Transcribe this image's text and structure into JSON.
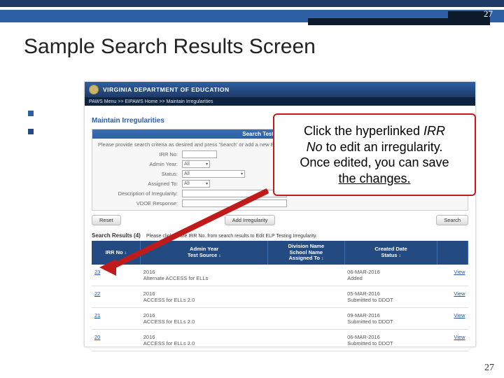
{
  "page_top": "27",
  "page_bottom": "27",
  "slide_title": "Sample Search Results Screen",
  "vdoe": {
    "title": "VIRGINIA DEPARTMENT OF EDUCATION",
    "crumb": "PAWS Menu >> EIPAWS Home >> Maintain Irregularities",
    "maintain": "Maintain Irregularities",
    "panel_hd": "Search Testing Irregularities",
    "intro": "Please provide search criteria as desired and press 'Search' or add a new ELP Testing Irregularity.",
    "labels": {
      "irr_no": "IRR No:",
      "admin_year": "Admin Year:",
      "status": "Status:",
      "assigned_to": "Assigned To:",
      "desc": "Description of Irregularity:",
      "vdoe_resp": "VDOE Response:"
    },
    "values": {
      "all": "All"
    },
    "buttons": {
      "reset": "Reset",
      "add": "Add Irregularity",
      "search": "Search"
    },
    "results_hd": "Search Results (4)",
    "results_sub": "Please click on the IRR No. from search results to Edit ELP Testing Irregularity.",
    "cols": {
      "c1a": "IRR No",
      "c1s": "↕",
      "c2a": "Admin Year",
      "c2b": "Test Source",
      "c2s": "↕",
      "c3a": "Division Name",
      "c3b": "School Name",
      "c3c": "Assigned To",
      "c3s": "↕",
      "c4a": "Created Date",
      "c4b": "Status",
      "c4s": "↕"
    },
    "rows": [
      {
        "irr": "23",
        "year": "2016",
        "src": "Alternate ACCESS for ELLs",
        "date": "06-MAR-2016",
        "status": "Added",
        "view": "View"
      },
      {
        "irr": "22",
        "year": "2016",
        "src": "ACCESS for ELLs 2.0",
        "date": "05-MAR-2016",
        "status": "Submitted to DDOT",
        "view": "View"
      },
      {
        "irr": "21",
        "year": "2016",
        "src": "ACCESS for ELLs 2.0",
        "date": "09-MAR-2016",
        "status": "Submitted to DDOT",
        "view": "View"
      },
      {
        "irr": "20",
        "year": "2016",
        "src": "ACCESS for ELLs 2.0",
        "date": "06-MAR-2016",
        "status": "Submitted to DDOT",
        "view": "View"
      }
    ]
  },
  "callout": {
    "l1a": "Click the hyperlinked ",
    "l1b": "IRR",
    "l2a": "No",
    "l2b": " to edit an irregularity.",
    "l3": "Once edited, you can save",
    "l4": "the changes."
  }
}
